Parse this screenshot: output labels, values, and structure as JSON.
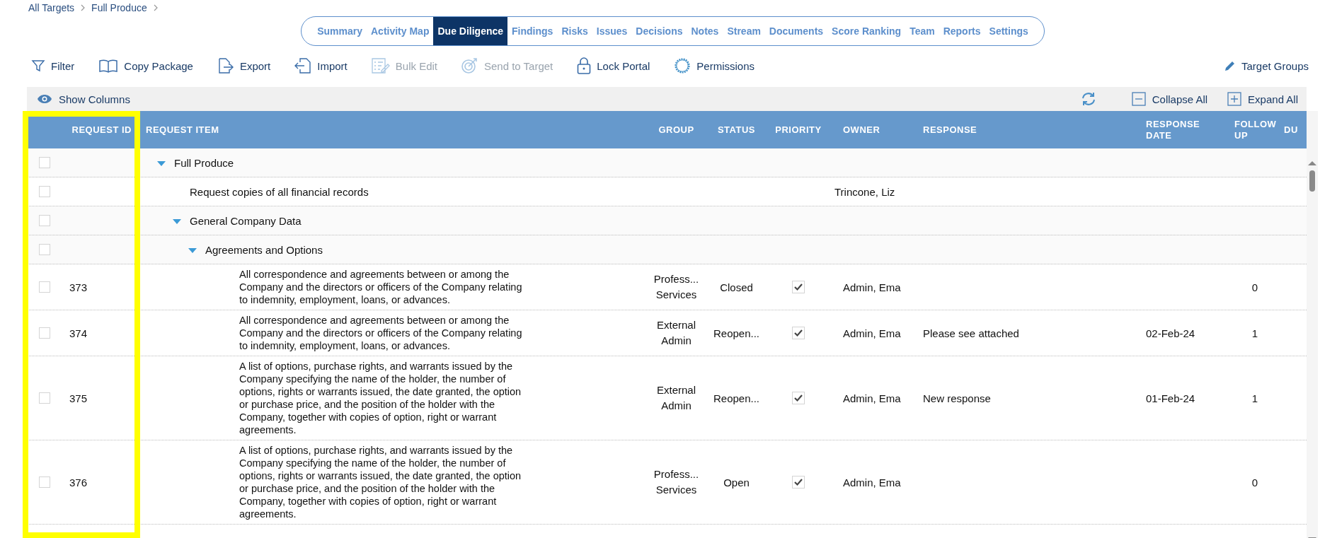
{
  "breadcrumb": [
    "All Targets",
    "Full Produce"
  ],
  "tabs": [
    {
      "label": "Summary",
      "selected": false
    },
    {
      "label": "Activity Map",
      "selected": false
    },
    {
      "label": "Due Diligence",
      "selected": true
    },
    {
      "label": "Findings",
      "selected": false
    },
    {
      "label": "Risks",
      "selected": false
    },
    {
      "label": "Issues",
      "selected": false
    },
    {
      "label": "Decisions",
      "selected": false
    },
    {
      "label": "Notes",
      "selected": false
    },
    {
      "label": "Stream",
      "selected": false
    },
    {
      "label": "Documents",
      "selected": false
    },
    {
      "label": "Score Ranking",
      "selected": false
    },
    {
      "label": "Team",
      "selected": false
    },
    {
      "label": "Reports",
      "selected": false
    },
    {
      "label": "Settings",
      "selected": false
    }
  ],
  "toolbar": [
    {
      "kind": "filter",
      "label": "Filter",
      "disabled": false
    },
    {
      "kind": "book",
      "label": "Copy Package",
      "disabled": false
    },
    {
      "kind": "export",
      "label": "Export",
      "disabled": false
    },
    {
      "kind": "import",
      "label": "Import",
      "disabled": false
    },
    {
      "kind": "checklist",
      "label": "Bulk Edit",
      "disabled": true
    },
    {
      "kind": "target",
      "label": "Send to Target",
      "disabled": true
    },
    {
      "kind": "lock",
      "label": "Lock Portal",
      "disabled": false
    },
    {
      "kind": "gear",
      "label": "Permissions",
      "disabled": false
    }
  ],
  "target_groups": "Target Groups",
  "grid_bar": {
    "show_columns": "Show Columns",
    "collapse_all": "Collapse All",
    "expand_all": "Expand All"
  },
  "table": {
    "columns": [
      "REQUEST ID",
      "REQUEST ITEM",
      "GROUP",
      "STATUS",
      "PRIORITY",
      "OWNER",
      "RESPONSE",
      "RESPONSE DATE",
      "FOLLOW UP",
      "DU"
    ],
    "rows": [
      {
        "request_item": "Full Produce",
        "checked": false,
        "expanded": true,
        "children": [
          {
            "request_item": "Request copies of all financial records",
            "owner": "Trincone, Liz",
            "checked": false
          },
          {
            "request_item": "General Company Data",
            "checked": false,
            "expanded": true,
            "children": [
              {
                "request_item": "Agreements and Options",
                "checked": false,
                "expanded": true,
                "children": [
                  {
                    "request_id": "373",
                    "request_item": "All correspondence and agreements between or among the Company and the directors or officers of the Company relating to indemnity, employment, loans, or advances.",
                    "group": "Profess... Services",
                    "status": "Closed",
                    "priority": true,
                    "owner": "Admin, Ema",
                    "follow_up": "0",
                    "checked": false
                  },
                  {
                    "request_id": "374",
                    "request_item": "All correspondence and agreements between or among the Company and the directors or officers of the Company relating to indemnity, employment, loans, or advances.",
                    "group": "External Admin",
                    "status": "Reopen...",
                    "priority": true,
                    "owner": "Admin, Ema",
                    "response": "Please see attached",
                    "response_date": "02-Feb-24",
                    "follow_up": "1",
                    "checked": false
                  },
                  {
                    "request_id": "375",
                    "request_item": "A list of options, purchase rights, and warrants issued by the Company specifying the name of the holder, the number of options, rights or warrants issued, the date granted, the option or purchase price, and the position of the holder with the Company, together with copies of option, right or warrant agreements.",
                    "group": "External Admin",
                    "status": "Reopen...",
                    "priority": true,
                    "owner": "Admin, Ema",
                    "response": "New response",
                    "response_date": "01-Feb-24",
                    "follow_up": "1",
                    "checked": false
                  },
                  {
                    "request_id": "376",
                    "request_item": "A list of options, purchase rights, and warrants issued by the Company specifying the name of the holder, the number of options, rights or warrants issued, the date granted, the option or purchase price, and the position of the holder with the Company, together with copies of option, right or warrant agreements.",
                    "group": "Profess... Services",
                    "status": "Open",
                    "priority": true,
                    "owner": "Admin, Ema",
                    "follow_up": "0",
                    "checked": false
                  }
                ]
              }
            ]
          }
        ]
      }
    ]
  }
}
